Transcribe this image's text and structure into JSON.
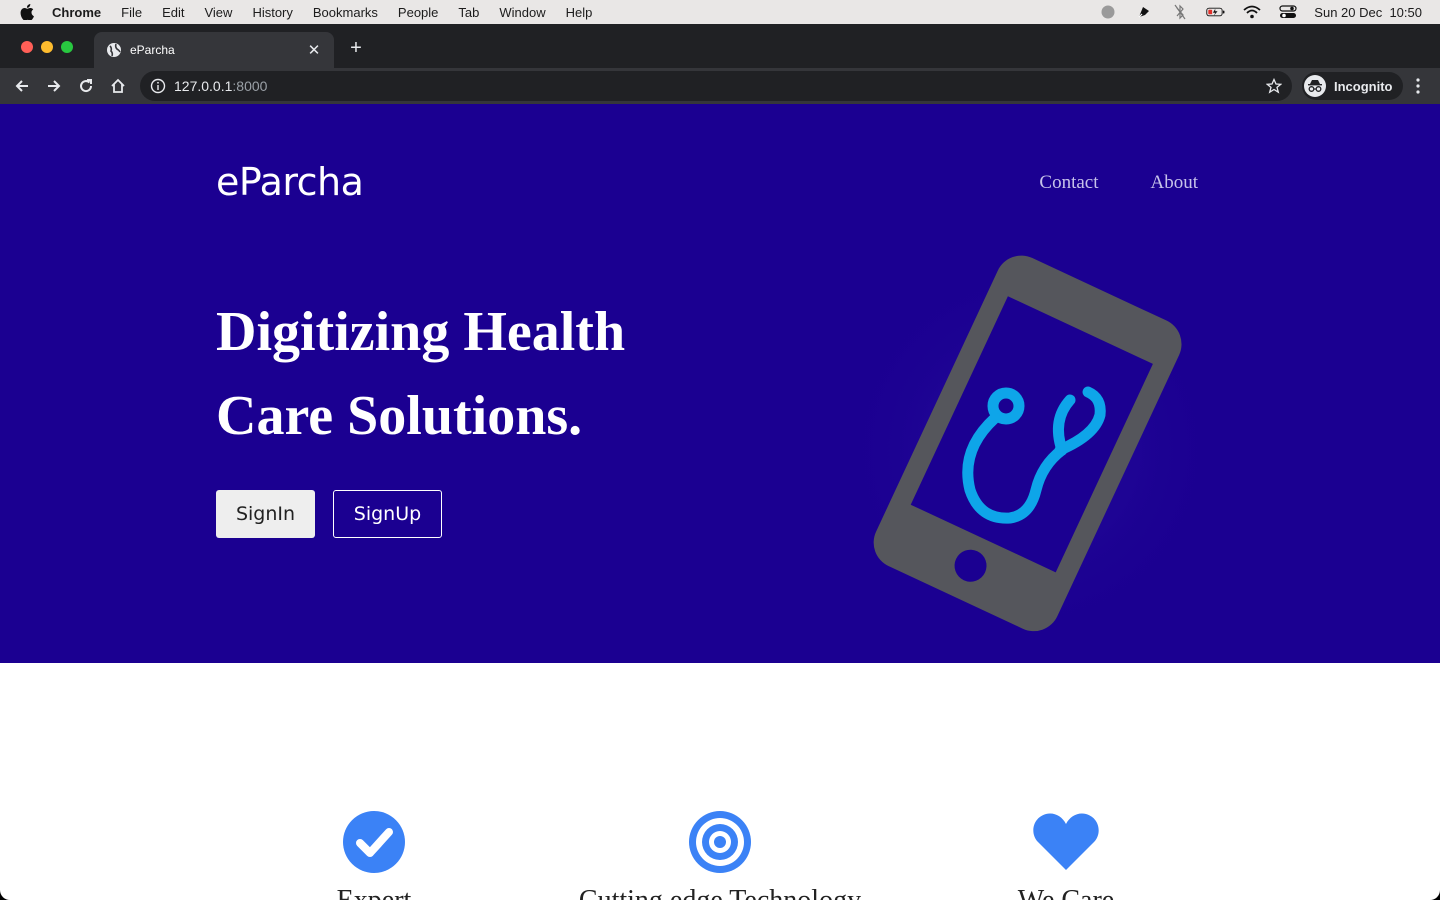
{
  "menubar": {
    "app_name": "Chrome",
    "items": [
      "File",
      "Edit",
      "View",
      "History",
      "Bookmarks",
      "People",
      "Tab",
      "Window",
      "Help"
    ],
    "clock": "Sun 20 Dec  10:50"
  },
  "browser": {
    "tab_title": "eParcha",
    "url_host": "127.0.0.1",
    "url_port": ":8000",
    "profile_label": "Incognito"
  },
  "page": {
    "brand": "eParcha",
    "nav": {
      "contact": "Contact",
      "about": "About"
    },
    "headline_line1": "Digitizing Health",
    "headline_line2": "Care Solutions.",
    "signin_label": "SignIn",
    "signup_label": "SignUp",
    "features": [
      {
        "icon": "check-circle-icon",
        "title": "Expert"
      },
      {
        "icon": "target-icon",
        "title": "Cutting edge Technology"
      },
      {
        "icon": "heart-icon",
        "title": "We Care"
      }
    ]
  },
  "colors": {
    "hero_bg": "#1b0091",
    "accent_blue": "#3b82f6",
    "stethoscope": "#0ea5e9",
    "phone_gray": "#55565c"
  }
}
